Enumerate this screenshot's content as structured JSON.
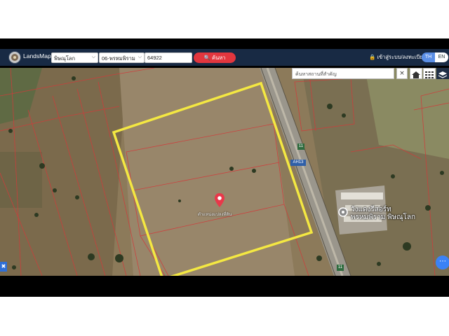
{
  "app": {
    "brand": "LandsMaps"
  },
  "toolbar": {
    "province": "พิษณุโลก",
    "district": "06-พรหมพิราม",
    "parcel_number": "64922",
    "search_label": "ค้นหา",
    "login_label": "เข้าสู่ระบบ/ลงทะเบียน",
    "lang_th": "TH",
    "lang_en": "EN"
  },
  "map": {
    "place_search_placeholder": "ค้นหาสถานที่สำคัญ",
    "road_badges": [
      "11",
      "AH13",
      "11"
    ],
    "poi_name_line1": "วังแดงรีสอร์ท",
    "poi_name_line2": "พรหมพิราม พิษณุโลก",
    "pin_label": "ตำแหน่งแปลงที่ดิน",
    "colors": {
      "highlight": "#f4e842",
      "parcel_lines": "#d23a3a",
      "pin": "#e8384a",
      "brand_bar": "#182a44"
    }
  }
}
